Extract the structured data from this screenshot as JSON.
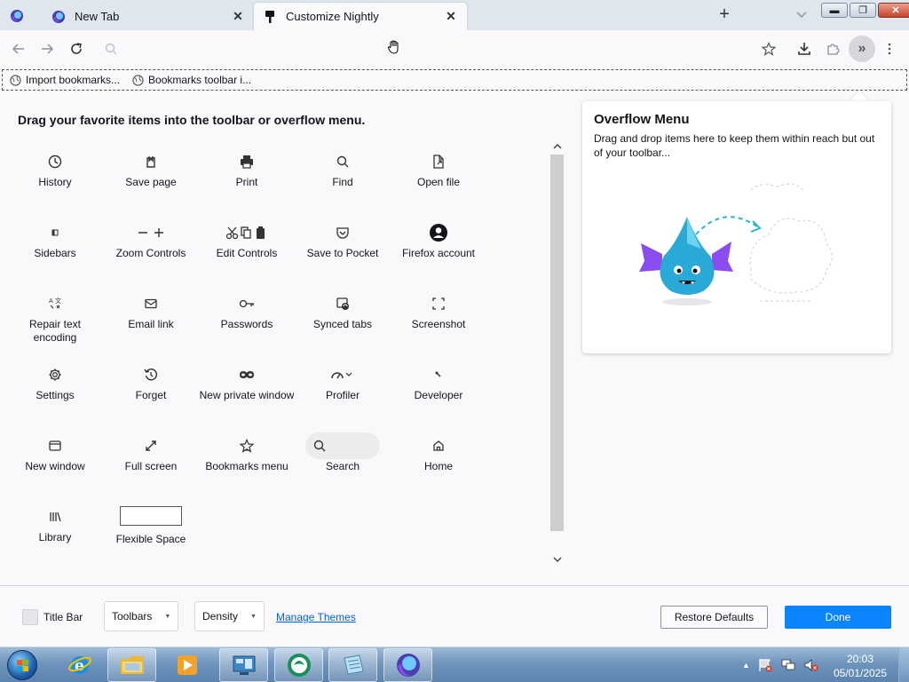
{
  "browser": {
    "tabs": [
      {
        "title": "New Tab",
        "icon": "firefox-nightly-icon"
      },
      {
        "title": "Customize Nightly",
        "icon": "customize-brush-icon",
        "active": true
      }
    ]
  },
  "bookmarks": [
    {
      "label": "Import bookmarks...",
      "icon": "globe-icon"
    },
    {
      "label": "Bookmarks toolbar i...",
      "icon": "globe-icon"
    }
  ],
  "customize": {
    "instructions": "Drag your favorite items into the toolbar or overflow menu.",
    "items": [
      {
        "label": "History",
        "icon": "clock-icon"
      },
      {
        "label": "Save page",
        "icon": "save-page-icon"
      },
      {
        "label": "Print",
        "icon": "printer-icon"
      },
      {
        "label": "Find",
        "icon": "magnifier-icon"
      },
      {
        "label": "Open file",
        "icon": "open-file-icon"
      },
      {
        "label": "Sidebars",
        "icon": "sidebar-icon"
      },
      {
        "label": "Zoom Controls",
        "icon": "zoom-controls-icon"
      },
      {
        "label": "Edit Controls",
        "icon": "edit-controls-icon"
      },
      {
        "label": "Save to Pocket",
        "icon": "pocket-icon"
      },
      {
        "label": "Firefox account",
        "icon": "account-icon"
      },
      {
        "label": "Repair text encoding",
        "icon": "text-encoding-icon"
      },
      {
        "label": "Email link",
        "icon": "mail-icon"
      },
      {
        "label": "Passwords",
        "icon": "key-icon"
      },
      {
        "label": "Synced tabs",
        "icon": "synced-tabs-icon"
      },
      {
        "label": "Screenshot",
        "icon": "screenshot-icon"
      },
      {
        "label": "Settings",
        "icon": "gear-icon"
      },
      {
        "label": "Forget",
        "icon": "forget-icon"
      },
      {
        "label": "New private window",
        "icon": "private-mask-icon"
      },
      {
        "label": "Profiler",
        "icon": "profiler-icon"
      },
      {
        "label": "Developer",
        "icon": "wrench-icon"
      },
      {
        "label": "New window",
        "icon": "window-icon"
      },
      {
        "label": "Full screen",
        "icon": "fullscreen-icon"
      },
      {
        "label": "Bookmarks menu",
        "icon": "bookmark-star-icon"
      },
      {
        "label": "Search",
        "icon": "search-icon"
      },
      {
        "label": "Home",
        "icon": "home-icon"
      },
      {
        "label": "Library",
        "icon": "library-icon"
      },
      {
        "label": "Flexible Space",
        "icon": "flexible-space-icon"
      }
    ]
  },
  "overflow": {
    "title": "Overflow Menu",
    "description": "Drag and drop items here to keep them within reach but out of your toolbar..."
  },
  "footer": {
    "title_bar_label": "Title Bar",
    "toolbars_label": "Toolbars",
    "density_label": "Density",
    "manage_themes": "Manage Themes",
    "restore_defaults": "Restore Defaults",
    "done": "Done"
  },
  "taskbar": {
    "time": "20:03",
    "date": "05/01/2025"
  },
  "colors": {
    "accent": "#0a84ff",
    "link": "#0060df",
    "tabstrip": "#dfe6ee"
  }
}
